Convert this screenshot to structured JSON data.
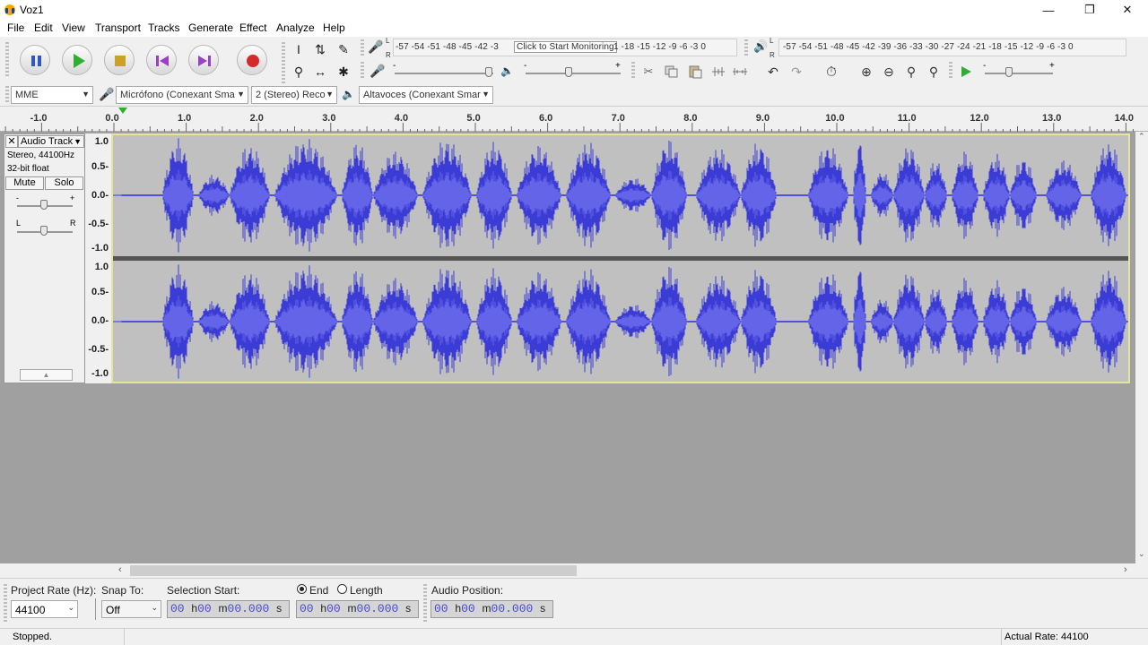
{
  "window": {
    "title": "Voz1"
  },
  "menu": [
    "File",
    "Edit",
    "View",
    "Transport",
    "Tracks",
    "Generate",
    "Effect",
    "Analyze",
    "Help"
  ],
  "meters": {
    "record_scale": "-57 -54 -51 -48 -45 -42 -3",
    "record_tooltip": "Click to Start Monitoring",
    "record_scale_tail": "1 -18 -15 -12  -9  -6  -3  0",
    "play_scale": "-57 -54 -51 -48 -45 -42 -39 -36 -33 -30 -27 -24 -21 -18 -15 -12  -9  -6  -3  0",
    "record_slider_level": 0.95,
    "play_slider_level": 0.45,
    "play_speed_level": 0.35
  },
  "device": {
    "host": "MME",
    "mic": "Micrófono (Conexant Sma",
    "channels": "2 (Stereo) Reco",
    "speaker": "Altavoces (Conexant Smar"
  },
  "ruler": {
    "labels": [
      "-1.0",
      "0.0",
      "1.0",
      "2.0",
      "3.0",
      "4.0",
      "5.0",
      "6.0",
      "7.0",
      "8.0",
      "9.0",
      "10.0",
      "11.0",
      "12.0",
      "13.0",
      "14.0"
    ]
  },
  "track": {
    "name": "Audio Track",
    "info1": "Stereo, 44100Hz",
    "info2": "32-bit float",
    "mute": "Mute",
    "solo": "Solo",
    "gain_minus": "-",
    "gain_plus": "+",
    "pan_left": "L",
    "pan_right": "R",
    "scale": [
      "1.0",
      "0.5-",
      "0.0-",
      "-0.5-",
      "-1.0"
    ]
  },
  "selection": {
    "project_rate_label": "Project Rate (Hz):",
    "project_rate": "44100",
    "snap_label": "Snap To:",
    "snap": "Off",
    "start_label": "Selection Start:",
    "end_label": "End",
    "length_label": "Length",
    "position_label": "Audio Position:",
    "time_digits_h": "00",
    "time_digits_m": "00",
    "time_digits_s": "00.000",
    "unit_h": "h",
    "unit_m": "m",
    "unit_s": "s"
  },
  "status": {
    "left": "Stopped.",
    "right": "Actual Rate: 44100"
  },
  "colors": {
    "waveform": "#3b3bd6",
    "waveform_rms": "#6464e8",
    "wave_bg": "#c0c0c0",
    "record": "#d42a2a",
    "play": "#2fae2f"
  }
}
